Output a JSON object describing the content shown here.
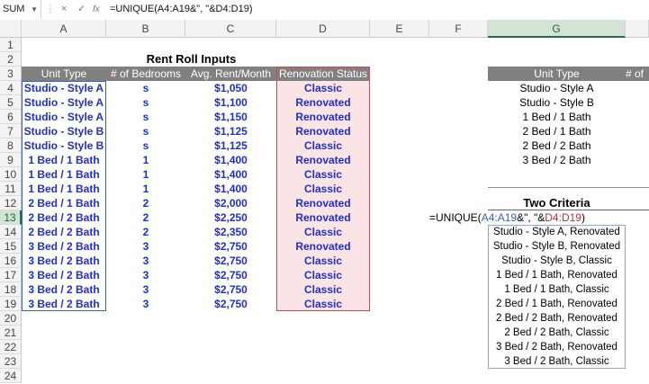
{
  "formula_bar": {
    "name_box": "SUM",
    "cancel_icon": "×",
    "enter_icon": "✓",
    "fx_label": "fx",
    "formula": "=UNIQUE(A4:A19&\", \"&D4:D19)"
  },
  "columns": [
    "A",
    "B",
    "C",
    "D",
    "E",
    "F",
    "G"
  ],
  "rows": [
    "1",
    "2",
    "3",
    "4",
    "5",
    "6",
    "7",
    "8",
    "9",
    "10",
    "11",
    "12",
    "13",
    "14",
    "15",
    "16",
    "17",
    "18",
    "19",
    "20",
    "21",
    "22",
    "23",
    "24"
  ],
  "title": "Rent Roll Inputs",
  "table": {
    "headers": [
      "Unit Type",
      "# of Bedrooms",
      "Avg. Rent/Month",
      "Renovation Status"
    ],
    "rows": [
      [
        "Studio - Style A",
        "s",
        "$1,050",
        "Classic"
      ],
      [
        "Studio - Style A",
        "s",
        "$1,100",
        "Renovated"
      ],
      [
        "Studio - Style A",
        "s",
        "$1,150",
        "Renovated"
      ],
      [
        "Studio - Style B",
        "s",
        "$1,125",
        "Renovated"
      ],
      [
        "Studio - Style B",
        "s",
        "$1,125",
        "Classic"
      ],
      [
        "1 Bed / 1 Bath",
        "1",
        "$1,400",
        "Renovated"
      ],
      [
        "1 Bed / 1 Bath",
        "1",
        "$1,400",
        "Classic"
      ],
      [
        "1 Bed / 1 Bath",
        "1",
        "$1,400",
        "Classic"
      ],
      [
        "2 Bed / 1 Bath",
        "2",
        "$2,000",
        "Renovated"
      ],
      [
        "2 Bed / 2 Bath",
        "2",
        "$2,250",
        "Renovated"
      ],
      [
        "2 Bed / 2 Bath",
        "2",
        "$2,350",
        "Classic"
      ],
      [
        "3 Bed / 2 Bath",
        "3",
        "$2,750",
        "Renovated"
      ],
      [
        "3 Bed / 2 Bath",
        "3",
        "$2,750",
        "Classic"
      ],
      [
        "3 Bed / 2 Bath",
        "3",
        "$2,750",
        "Classic"
      ],
      [
        "3 Bed / 2 Bath",
        "3",
        "$2,750",
        "Classic"
      ],
      [
        "3 Bed / 2 Bath",
        "3",
        "$2,750",
        "Classic"
      ]
    ]
  },
  "unique_table": {
    "header_g": "Unit Type",
    "header_h": "# of",
    "values": [
      "Studio - Style A",
      "Studio - Style B",
      "1 Bed / 1 Bath",
      "2 Bed / 1 Bath",
      "2 Bed / 2 Bath",
      "3 Bed / 2 Bath"
    ]
  },
  "two_criteria": {
    "title": "Two Criteria",
    "formula_parts": [
      "=UNIQUE(",
      "A4:A19",
      "&\", \"&",
      "D4:D19",
      ")"
    ],
    "values": [
      "Studio - Style A, Renovated",
      "Studio - Style B, Renovated",
      "Studio - Style B, Classic",
      "1 Bed / 1 Bath, Renovated",
      "1 Bed / 1 Bath, Classic",
      "2 Bed / 1 Bath, Renovated",
      "2 Bed / 2 Bath, Renovated",
      "2 Bed / 2 Bath, Classic",
      "3 Bed / 2 Bath, Renovated",
      "3 Bed / 2 Bath, Classic"
    ]
  },
  "colors": {
    "header_bg": "#808080",
    "blue_text": "#1f2fd0",
    "renovation_fill": "#fbe4e6",
    "renovation_border": "#d2484f",
    "ref_blue": "#2f63d8",
    "ref_red": "#c0303c",
    "selected_green": "#217346"
  }
}
